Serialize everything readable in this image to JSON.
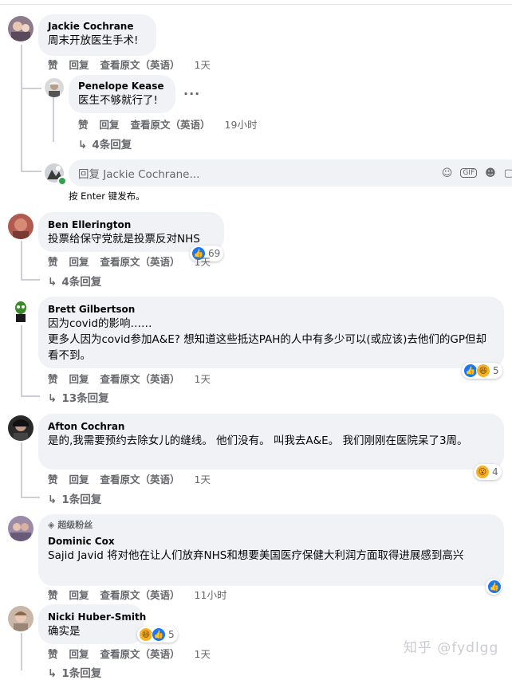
{
  "common": {
    "like": "赞",
    "reply": "回复",
    "see_original": "查看原文（英语）"
  },
  "c1": {
    "name": "Jackie Cochrane",
    "text": "周末开放医生手术!",
    "time": "1天",
    "reply": {
      "name": "Penelope Kease",
      "text": "医生不够就行了!",
      "time": "19小时"
    },
    "replies": "4条回复",
    "reply_placeholder": "回复 Jackie Cochrane...",
    "hint": "按 Enter 键发布。"
  },
  "c2": {
    "name": "Ben Ellerington",
    "text": "投票给保守党就是投票反对NHS",
    "time": "1天",
    "reactions": "69",
    "replies": "4条回复"
  },
  "c3": {
    "name": "Brett Gilbertson",
    "text1": "因为covid的影响……",
    "text2": "更多人因为covid参加A&E? 想知道这些抵达PAH的人中有多少可以(或应该)去他们的GP但却看不到。",
    "time": "1天",
    "reactions": "5",
    "replies": "13条回复"
  },
  "c4": {
    "name": "Afton Cochran",
    "text": "是的,我需要预约去除女儿的缝线。 他们没有。 叫我去A&E。 我们刚刚在医院呆了3周。",
    "time": "1天",
    "reactions": "4",
    "replies": "1条回复"
  },
  "c5": {
    "badge": "超级粉丝",
    "name": "Dominic Cox",
    "text": "Sajid Javid 将对他在让人们放弃NHS和想要美国医疗保健大利润方面取得进展感到高兴",
    "time": "11小时"
  },
  "c6": {
    "name": "Nicki Huber-Smith",
    "text": "确实是",
    "time": "1天",
    "reactions": "5",
    "replies": "1条回复"
  },
  "watermark": "知乎 @fydlgg",
  "colors": {
    "bubble": "#f0f2f5",
    "meta": "#65676b",
    "like": "#1877f2",
    "haha": "#f7b125"
  },
  "icons": [
    "emoji-icon",
    "gif-icon",
    "sticker-icon",
    "reply-arrow-icon",
    "like-reaction-icon",
    "haha-reaction-icon",
    "wow-reaction-icon",
    "diamond-badge-icon",
    "more-options-icon"
  ]
}
